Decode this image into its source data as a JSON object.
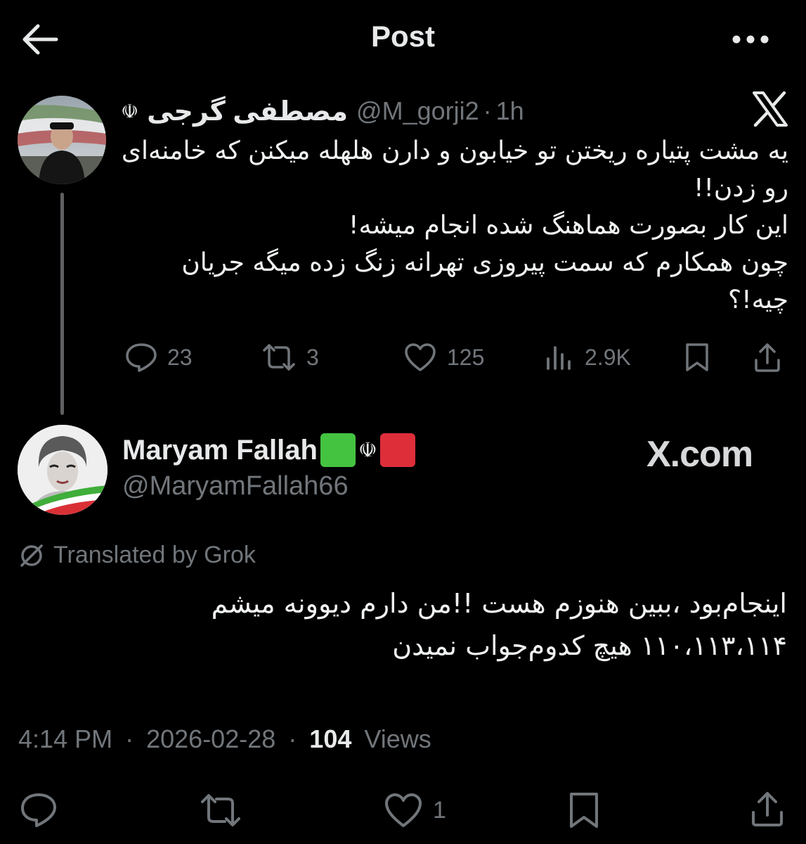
{
  "header": {
    "title": "Post",
    "back_icon": "arrow-left-icon",
    "more_icon": "more-horizontal-icon"
  },
  "parent_tweet": {
    "display_name": "مصطفی گرجی",
    "emblem": "☫",
    "handle": "@M_gorji2",
    "separator": "·",
    "time": "1h",
    "source_logo": "x-logo-icon",
    "text": "یه مشت پتیاره ریختن تو خیابون و دارن هلهله میکنن که خامنه‌ای رو زدن!!\nاین کار بصورت هماهنگ شده انجام میشه!\nچون همکارم که سمت پیروزی تهرانه زنگ زده میگه جریان چیه!؟",
    "stats": {
      "replies": "23",
      "reposts": "3",
      "likes": "125",
      "views": "2.9K"
    }
  },
  "reply_tweet": {
    "display_name": "Maryam Fallah",
    "emblem": "☫",
    "handle": "@MaryamFallah66",
    "watermark": "X.com",
    "translated_label": "Translated by Grok",
    "text": "اینجام‌بود ،ببین هنوزم هست !!من دارم دیوونه میشم\n۱۱۰،۱۱۳،۱۱۴ هیچ کدوم‌جواب نمیدن",
    "time": "4:14 PM",
    "date": "2026-02-28",
    "dot": "·",
    "views_count": "104",
    "views_label": "Views",
    "likes": "1"
  },
  "colors": {
    "background": "#000000",
    "text_primary": "#e7e9ea",
    "text_secondary": "#71767b",
    "thread_line": "#5e5f61",
    "flag_green": "#44c340",
    "flag_red": "#dd2e3a"
  }
}
